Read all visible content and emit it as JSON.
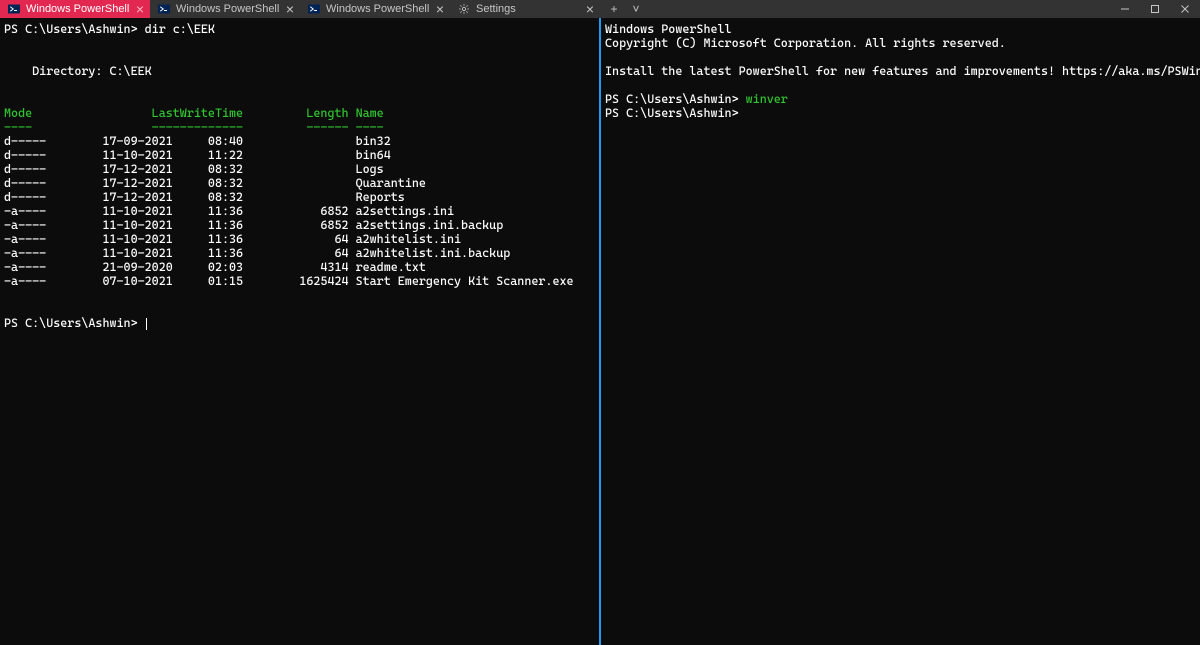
{
  "tabs": [
    {
      "label": "Windows PowerShell",
      "icon": "ps",
      "active": true
    },
    {
      "label": "Windows PowerShell",
      "icon": "ps",
      "active": false
    },
    {
      "label": "Windows PowerShell",
      "icon": "ps",
      "active": false
    },
    {
      "label": "Settings",
      "icon": "gear",
      "active": false
    }
  ],
  "newtab_plus": "+",
  "newtab_chevron": "˅",
  "window": {
    "min": "—",
    "max": "▢",
    "close": "✕"
  },
  "left": {
    "prompt1": "PS C:\\Users\\Ashwin>",
    "cmd1": "dir c:\\EEK",
    "blank": "",
    "dirline": "    Directory: C:\\EEK",
    "header": "Mode                 LastWriteTime         Length Name",
    "underline": "----                 -------------         ------ ----",
    "rows": [
      "d-----        17-09-2021     08:40                bin32",
      "d-----        11-10-2021     11:22                bin64",
      "d-----        17-12-2021     08:32                Logs",
      "d-----        17-12-2021     08:32                Quarantine",
      "d-----        17-12-2021     08:32                Reports",
      "-a----        11-10-2021     11:36           6852 a2settings.ini",
      "-a----        11-10-2021     11:36           6852 a2settings.ini.backup",
      "-a----        11-10-2021     11:36             64 a2whitelist.ini",
      "-a----        11-10-2021     11:36             64 a2whitelist.ini.backup",
      "-a----        21-09-2020     02:03           4314 readme.txt",
      "-a----        07-10-2021     01:15        1625424 Start Emergency Kit Scanner.exe"
    ],
    "prompt2": "PS C:\\Users\\Ashwin>"
  },
  "right": {
    "line1": "Windows PowerShell",
    "line2": "Copyright (C) Microsoft Corporation. All rights reserved.",
    "line3": "Install the latest PowerShell for new features and improvements! https://aka.ms/PSWindows",
    "prompt1": "PS C:\\Users\\Ashwin>",
    "cmd1": "winver",
    "prompt2": "PS C:\\Users\\Ashwin>"
  }
}
